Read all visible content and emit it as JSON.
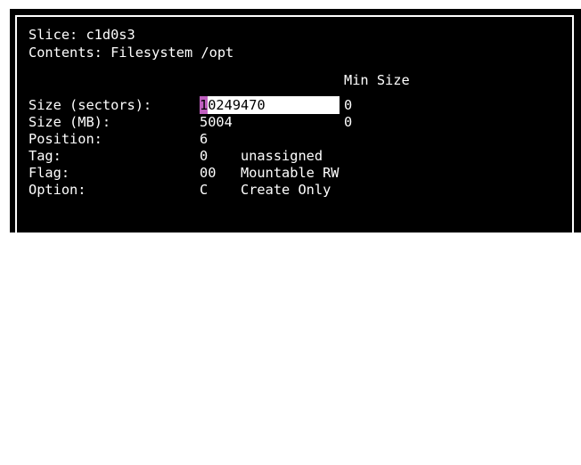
{
  "slice_line": "Slice: c1d0s3",
  "contents_line": "Contents: Filesystem /opt",
  "min_size_header": "Min Size",
  "fields": {
    "size_sectors": {
      "label": "Size (sectors):",
      "value_cursor_char": "1",
      "value_rest": "0249470",
      "min": "0"
    },
    "size_mb": {
      "label": "Size (MB):",
      "value": "5004",
      "min": "0"
    },
    "position": {
      "label": "Position:",
      "value": "6"
    },
    "tag": {
      "label": "Tag:",
      "value": "0",
      "desc": "unassigned"
    },
    "flag": {
      "label": "Flag:",
      "value": "00",
      "desc": "Mountable RW"
    },
    "option": {
      "label": "Option:",
      "value": "C",
      "desc": "Create Only"
    }
  },
  "colors": {
    "background": "#000000",
    "text": "#ffffff",
    "input_background": "#ffffff",
    "cursor": "#c060c0"
  }
}
